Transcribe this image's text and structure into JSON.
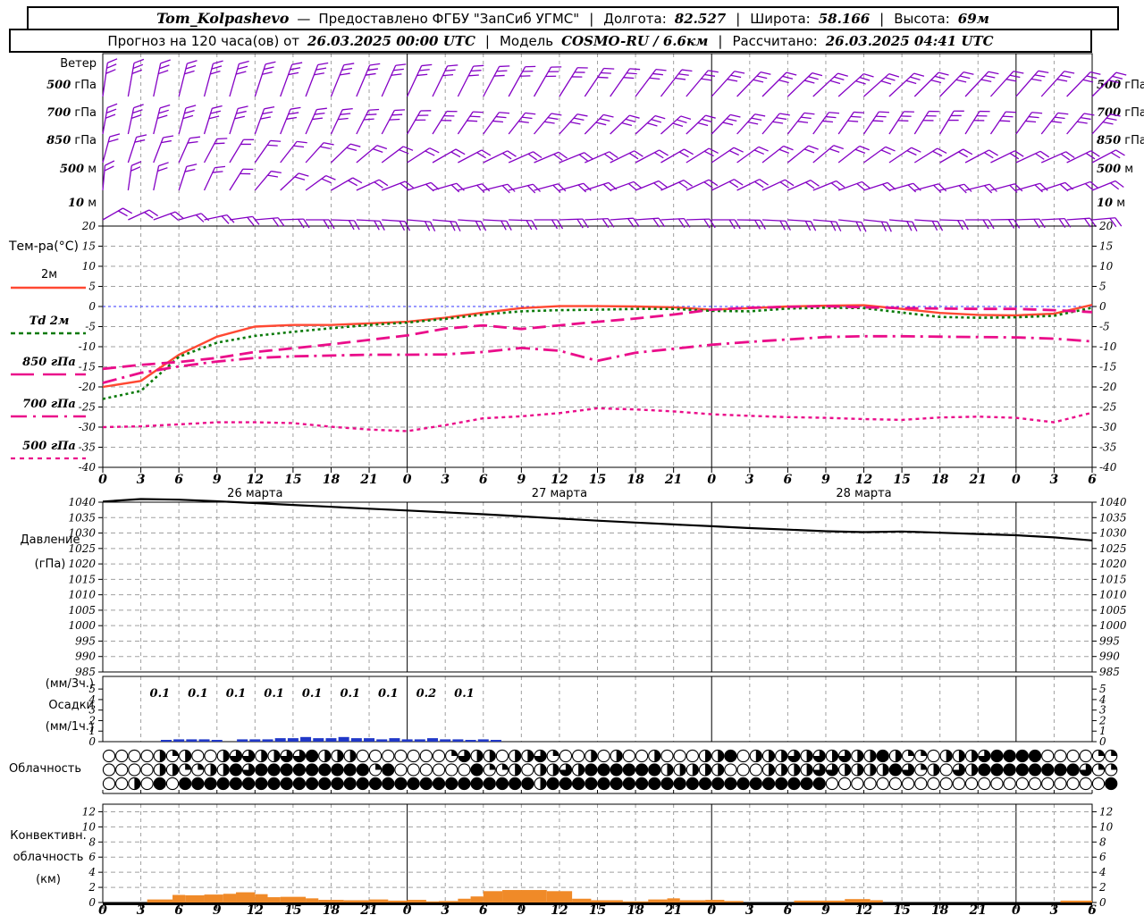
{
  "header": {
    "line1": {
      "station": "Tom_Kolpashevo",
      "dash": "—",
      "provider": "Предоставлено ФГБУ \"ЗапСиб УГМС\"",
      "sep": "|",
      "lon_label": "Долгота:",
      "lon": "82.527",
      "lat_label": "Широта:",
      "lat": "58.166",
      "alt_label": "Высота:",
      "alt": "69м"
    },
    "line2": {
      "forecast_label": "Прогноз на 120 часа(ов) от",
      "forecast_time": "26.03.2025 00:00 UTC",
      "sep": "|",
      "model_label": "Модель",
      "model": "COSMO-RU / 6.6км",
      "calc_label": "Рассчитано:",
      "calc_time": "26.03.2025 04:41 UTC"
    }
  },
  "labels": {
    "wind": {
      "title": "Ветер",
      "levels": [
        {
          "num": "500",
          "unit": "гПа"
        },
        {
          "num": "700",
          "unit": "гПа"
        },
        {
          "num": "850",
          "unit": "гПа"
        },
        {
          "num": "500",
          "unit": "м"
        },
        {
          "num": "10",
          "unit": "м"
        }
      ]
    },
    "temp": {
      "title": "Тем-ра(°C)",
      "legend": [
        {
          "name": "2м"
        },
        {
          "name": "Td  2м"
        },
        {
          "name": "850 гПа"
        },
        {
          "name": "700 гПа"
        },
        {
          "name": "500 гПа"
        }
      ]
    },
    "pressure": {
      "line1": "Давление",
      "line2": "(гПа)"
    },
    "precip": {
      "line1": "(мм/3ч.)",
      "line2": "Осадки",
      "line3": "(мм/1ч.)"
    },
    "cloud": {
      "title": "Облачность"
    },
    "conv": {
      "line1": "Конвективн.",
      "line2": "облачность",
      "line3": "(км)"
    }
  },
  "time_axis": {
    "hours": [
      "0",
      "3",
      "6",
      "9",
      "12",
      "15",
      "18",
      "21",
      "0",
      "3",
      "6",
      "9",
      "12",
      "15",
      "18",
      "21",
      "0",
      "3",
      "6",
      "9",
      "12",
      "15",
      "18",
      "21",
      "0",
      "3",
      "6"
    ],
    "dates": [
      "26 марта",
      "27 марта",
      "28 марта"
    ],
    "date_hours": [
      12,
      36,
      60
    ]
  },
  "colors": {
    "barb": "#8400c4",
    "t2m": "#ff4832",
    "td2m": "#0a7a0a",
    "t850": "#ea0d8a",
    "t700": "#ea0d8a",
    "t500": "#ea0d8a",
    "zero_line": "#3333ff",
    "pressure": "#000000",
    "precip_bar": "#2038c8",
    "conv_bar": "#f08a28",
    "grid": "#a0a0a0",
    "frame": "#000000"
  },
  "chart_data": [
    {
      "id": "wind",
      "type": "wind-barbs",
      "x_step_hours": 2,
      "levels": [
        {
          "name": "500 гПа",
          "ticks": 3,
          "angles": [
            8,
            10,
            12,
            14,
            15,
            16,
            18,
            20,
            21,
            22,
            23,
            24,
            25,
            26,
            27,
            28,
            29,
            30,
            32,
            34,
            35,
            37,
            38,
            40,
            42,
            44,
            45,
            46,
            47,
            48,
            48,
            47,
            45,
            44,
            43,
            42,
            41,
            42,
            44,
            45
          ]
        },
        {
          "name": "700 гПа",
          "ticks": 3,
          "angles": [
            10,
            12,
            14,
            15,
            17,
            18,
            20,
            22,
            24,
            25,
            27,
            28,
            30,
            32,
            34,
            36,
            38,
            40,
            42,
            44,
            46,
            47,
            48,
            46,
            44,
            42,
            40,
            38,
            36,
            35,
            34,
            33,
            32,
            31,
            32,
            34,
            36,
            38,
            40,
            42
          ]
        },
        {
          "name": "850 гПа",
          "ticks": 2,
          "angles": [
            15,
            18,
            21,
            24,
            28,
            31,
            35,
            38,
            42,
            46,
            50,
            53,
            57,
            60,
            62,
            64,
            66,
            67,
            68,
            66,
            64,
            62,
            60,
            58,
            56,
            54,
            52,
            51,
            50,
            52,
            54,
            56,
            58,
            60,
            62,
            64,
            65,
            66,
            64,
            62
          ]
        },
        {
          "name": "500 м",
          "ticks": 2,
          "angles": [
            5,
            8,
            12,
            18,
            25,
            32,
            40,
            47,
            54,
            60,
            65,
            69,
            72,
            74,
            75,
            76,
            76,
            75,
            74,
            72,
            70,
            68,
            66,
            65,
            64,
            64,
            65,
            66,
            68,
            70,
            72,
            74,
            75,
            76,
            76,
            75,
            74,
            72,
            70,
            68
          ]
        },
        {
          "name": "10 м",
          "ticks": 2,
          "angles": [
            60,
            65,
            70,
            74,
            78,
            82,
            85,
            88,
            90,
            92,
            93,
            94,
            95,
            95,
            94,
            93,
            92,
            90,
            88,
            87,
            86,
            86,
            87,
            88,
            90,
            91,
            93,
            94,
            95,
            96,
            96,
            95,
            94,
            92,
            90,
            89,
            88,
            87,
            86,
            85
          ]
        }
      ]
    },
    {
      "id": "temperature",
      "type": "line",
      "title": "Тем-ра(°C)",
      "x_step_hours": 3,
      "xlim": [
        0,
        78
      ],
      "ylim": [
        -40,
        20
      ],
      "yticks": [
        20,
        15,
        10,
        5,
        0,
        -5,
        -10,
        -15,
        -20,
        -25,
        -30,
        -35,
        -40
      ],
      "series": [
        {
          "name": "2м",
          "style": "solid",
          "values": [
            -20,
            -18.5,
            -12,
            -7.5,
            -5,
            -4.6,
            -4.6,
            -4.2,
            -3.8,
            -2.8,
            -1.5,
            -0.4,
            0.1,
            0.1,
            0,
            -0.2,
            -0.8,
            -0.4,
            0,
            0.2,
            0.3,
            -0.6,
            -1.6,
            -2.1,
            -2.2,
            -1.8,
            0.4
          ]
        },
        {
          "name": "Td 2м",
          "style": "dotted",
          "values": [
            -23,
            -21,
            -12.5,
            -9,
            -7.3,
            -6.3,
            -5.4,
            -4.6,
            -4,
            -3.1,
            -2,
            -1.2,
            -0.9,
            -0.8,
            -0.6,
            -0.6,
            -1.1,
            -1.2,
            -0.5,
            -0.3,
            -0.4,
            -1.5,
            -2.6,
            -2.8,
            -2.7,
            -2.3,
            -0.3
          ]
        },
        {
          "name": "850 гПа",
          "style": "longdash",
          "values": [
            -15.5,
            -14.5,
            -13.8,
            -12.8,
            -11.3,
            -10.4,
            -9.4,
            -8.3,
            -7.2,
            -5.5,
            -4.7,
            -5.6,
            -4.7,
            -3.8,
            -3,
            -2,
            -0.8,
            -0.3,
            -0.1,
            0.1,
            -0.2,
            -0.4,
            -0.5,
            -0.6,
            -0.6,
            -0.9,
            -1.4
          ]
        },
        {
          "name": "700 гПа",
          "style": "dashdot",
          "values": [
            -19,
            -16.5,
            -14.9,
            -13.7,
            -12.8,
            -12.4,
            -12.2,
            -12,
            -12,
            -11.9,
            -11.3,
            -10.3,
            -11,
            -13.5,
            -11.5,
            -10.5,
            -9.5,
            -8.8,
            -8.2,
            -7.6,
            -7.4,
            -7.4,
            -7.5,
            -7.6,
            -7.7,
            -8,
            -8.7
          ]
        },
        {
          "name": "500 гПа",
          "style": "shortdash",
          "values": [
            -30,
            -29.8,
            -29.3,
            -28.8,
            -28.8,
            -29,
            -29.9,
            -30.6,
            -31,
            -29.5,
            -27.8,
            -27.3,
            -26.5,
            -25.3,
            -25.6,
            -26.1,
            -26.8,
            -27.2,
            -27.5,
            -27.7,
            -28,
            -28.2,
            -27.6,
            -27.4,
            -27.7,
            -28.8,
            -26.4
          ]
        }
      ]
    },
    {
      "id": "pressure",
      "type": "line",
      "x_step_hours": 3,
      "ylim": [
        985,
        1040
      ],
      "yticks": [
        1040,
        1035,
        1030,
        1025,
        1020,
        1015,
        1010,
        1005,
        1000,
        995,
        990,
        985
      ],
      "series": [
        {
          "name": "Давление",
          "values": [
            1040.2,
            1041,
            1040.8,
            1040.3,
            1039.7,
            1039.1,
            1038.5,
            1037.9,
            1037.3,
            1036.7,
            1036.1,
            1035.4,
            1034.7,
            1034,
            1033.4,
            1032.8,
            1032.2,
            1031.6,
            1031.1,
            1030.6,
            1030.3,
            1030.5,
            1030.1,
            1029.7,
            1029.3,
            1028.6,
            1027.6
          ]
        }
      ]
    },
    {
      "id": "precipitation",
      "type": "bar",
      "ylim": [
        0,
        6
      ],
      "yticks": [
        0,
        1,
        2,
        3,
        4,
        5
      ],
      "labels_3h": {
        "centers": [
          4.5,
          7.5,
          10.5,
          13.5,
          16.5,
          19.5,
          22.5,
          25.5,
          28.5
        ],
        "values": [
          "0.1",
          "0.1",
          "0.1",
          "0.1",
          "0.1",
          "0.1",
          "0.1",
          "0.2",
          "0.1"
        ]
      },
      "bars_1h": {
        "start_hour": 5,
        "values": [
          0.05,
          0.1,
          0.1,
          0.1,
          0.05,
          0,
          0.1,
          0.1,
          0.1,
          0.15,
          0.15,
          0.2,
          0.15,
          0.15,
          0.2,
          0.15,
          0.15,
          0.1,
          0.15,
          0.1,
          0.1,
          0.15,
          0.1,
          0.1,
          0.05,
          0.1,
          0.05
        ]
      }
    },
    {
      "id": "cloudiness",
      "type": "cloud-symbols",
      "quarters_scale": 4,
      "rows": [
        [
          0,
          0,
          0,
          0,
          2,
          1,
          2,
          0,
          0,
          2,
          3,
          3,
          2,
          2,
          3,
          3,
          4,
          2,
          2,
          2,
          0,
          0,
          0,
          0,
          0,
          0,
          0,
          1,
          3,
          2,
          2,
          0,
          2,
          2,
          3,
          1,
          0,
          0,
          2,
          0,
          2,
          0,
          0,
          2,
          0,
          0,
          0,
          2,
          2,
          4,
          0,
          2,
          2,
          2,
          3,
          2,
          3,
          2,
          3,
          2,
          2,
          4,
          2,
          1,
          1,
          0,
          2,
          2,
          2,
          3,
          4,
          4,
          4,
          4,
          0,
          0,
          0,
          0,
          1,
          1
        ],
        [
          0,
          0,
          0,
          0,
          2,
          2,
          1,
          1,
          2,
          2,
          4,
          3,
          4,
          4,
          4,
          4,
          4,
          4,
          4,
          4,
          4,
          1,
          4,
          0,
          0,
          0,
          0,
          0,
          0,
          4,
          1,
          1,
          2,
          0,
          2,
          2,
          3,
          2,
          4,
          4,
          4,
          4,
          4,
          4,
          2,
          2,
          2,
          2,
          2,
          0,
          0,
          0,
          2,
          2,
          2,
          2,
          3,
          3,
          2,
          2,
          2,
          2,
          4,
          3,
          1,
          2,
          0,
          3,
          2,
          4,
          4,
          4,
          4,
          4,
          4,
          4,
          4,
          3,
          1,
          1
        ],
        [
          0,
          0,
          2,
          0,
          4,
          0,
          4,
          4,
          4,
          4,
          4,
          4,
          4,
          4,
          4,
          4,
          4,
          4,
          4,
          4,
          4,
          4,
          4,
          4,
          4,
          4,
          4,
          4,
          4,
          4,
          4,
          4,
          4,
          4,
          2,
          4,
          4,
          4,
          4,
          4,
          4,
          4,
          4,
          4,
          4,
          4,
          4,
          4,
          4,
          4,
          4,
          4,
          4,
          4,
          4,
          4,
          4,
          0,
          0,
          0,
          0,
          0,
          0,
          0,
          0,
          0,
          0,
          0,
          0,
          0,
          0,
          0,
          0,
          0,
          0,
          0,
          0,
          0,
          0,
          4
        ]
      ]
    },
    {
      "id": "convective",
      "type": "bar",
      "ylim": [
        0,
        13
      ],
      "yticks": [
        0,
        2,
        4,
        6,
        8,
        10,
        12
      ],
      "segments": [
        [
          3.5,
          5.5,
          0.4
        ],
        [
          5.5,
          6.5,
          1.0
        ],
        [
          6.5,
          8,
          0.95
        ],
        [
          8,
          9.5,
          1.05
        ],
        [
          9.5,
          10.5,
          1.15
        ],
        [
          10.5,
          12,
          1.35
        ],
        [
          12,
          13,
          1.1
        ],
        [
          13,
          14,
          0.7
        ],
        [
          14,
          16,
          0.75
        ],
        [
          16,
          17,
          0.55
        ],
        [
          17,
          19,
          0.35
        ],
        [
          19,
          21,
          0.3
        ],
        [
          21,
          22.5,
          0.4
        ],
        [
          22.5,
          24,
          0.25
        ],
        [
          24,
          25.5,
          0.35
        ],
        [
          25.5,
          26.5,
          0.15
        ],
        [
          26.5,
          28,
          0.2
        ],
        [
          28,
          29,
          0.5
        ],
        [
          29,
          30,
          0.8
        ],
        [
          30,
          31.5,
          1.5
        ],
        [
          31.5,
          35,
          1.65
        ],
        [
          35,
          37,
          1.5
        ],
        [
          37,
          38.5,
          0.5
        ],
        [
          38.5,
          41,
          0.3
        ],
        [
          41,
          43,
          0.15
        ],
        [
          43,
          44.5,
          0.4
        ],
        [
          44.5,
          45.5,
          0.55
        ],
        [
          45.5,
          47.5,
          0.3
        ],
        [
          47.5,
          49,
          0.35
        ],
        [
          49,
          50.5,
          0.2
        ],
        [
          54.5,
          58.5,
          0.25
        ],
        [
          58.5,
          60.5,
          0.45
        ],
        [
          60.5,
          61.5,
          0.3
        ],
        [
          75.5,
          78,
          0.25
        ]
      ]
    }
  ]
}
